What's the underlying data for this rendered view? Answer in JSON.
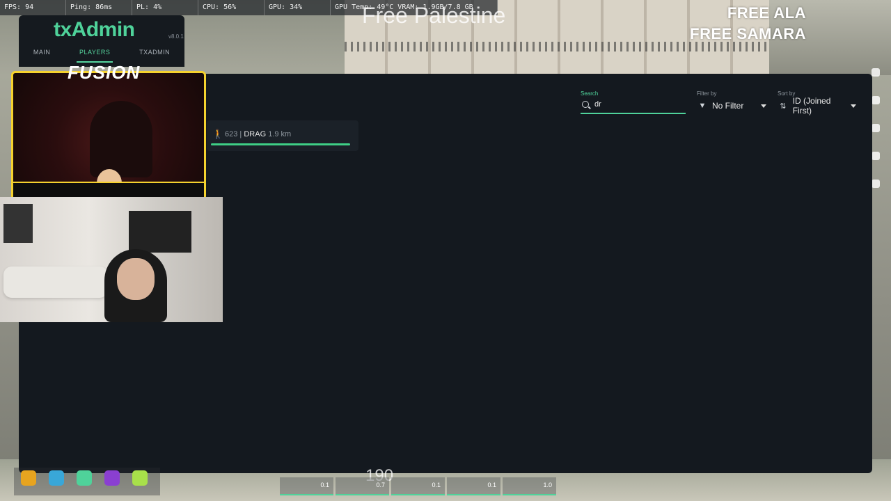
{
  "perf": {
    "fps": "FPS: 94",
    "ping": "Ping: 86ms",
    "pl": "PL: 4%",
    "cpu": "CPU: 56%",
    "gpu": "GPU: 34%",
    "gpu_temp_vram": "GPU Temp: 49°C   VRAM: 1.9GB/7.8 GB"
  },
  "stream_overlay": {
    "headline": "Free Palestine",
    "line1": "FREE ALA",
    "line2": "FREE SAMARA",
    "cam_label": "FUSION"
  },
  "txadmin": {
    "logo": "txAdmin",
    "version": "v8.0.1",
    "nav": [
      {
        "label": "MAIN",
        "active": false
      },
      {
        "label": "PLAYERS",
        "active": true
      },
      {
        "label": "TXADMIN",
        "active": false
      }
    ]
  },
  "players_panel": {
    "search": {
      "label": "Search",
      "value": "dr"
    },
    "filter": {
      "label": "Filter by",
      "value": "No Filter",
      "icon": "filter-icon"
    },
    "sort": {
      "label": "Sort by",
      "value": "ID (Joined First)",
      "icon": "sort-icon"
    },
    "players": [
      {
        "id": "623",
        "separator": "|",
        "name": "DRAG",
        "distance": "1.9 km",
        "health": 1.0,
        "icon": "walking-icon"
      }
    ]
  },
  "hud": {
    "speed": "190",
    "cells": [
      "0.1",
      "0.7",
      "0.1",
      "0.1",
      "1.0"
    ]
  },
  "colors": {
    "accent": "#4fd29a",
    "panel_bg": "#14191f",
    "webcam_border": "#f5d22e"
  }
}
